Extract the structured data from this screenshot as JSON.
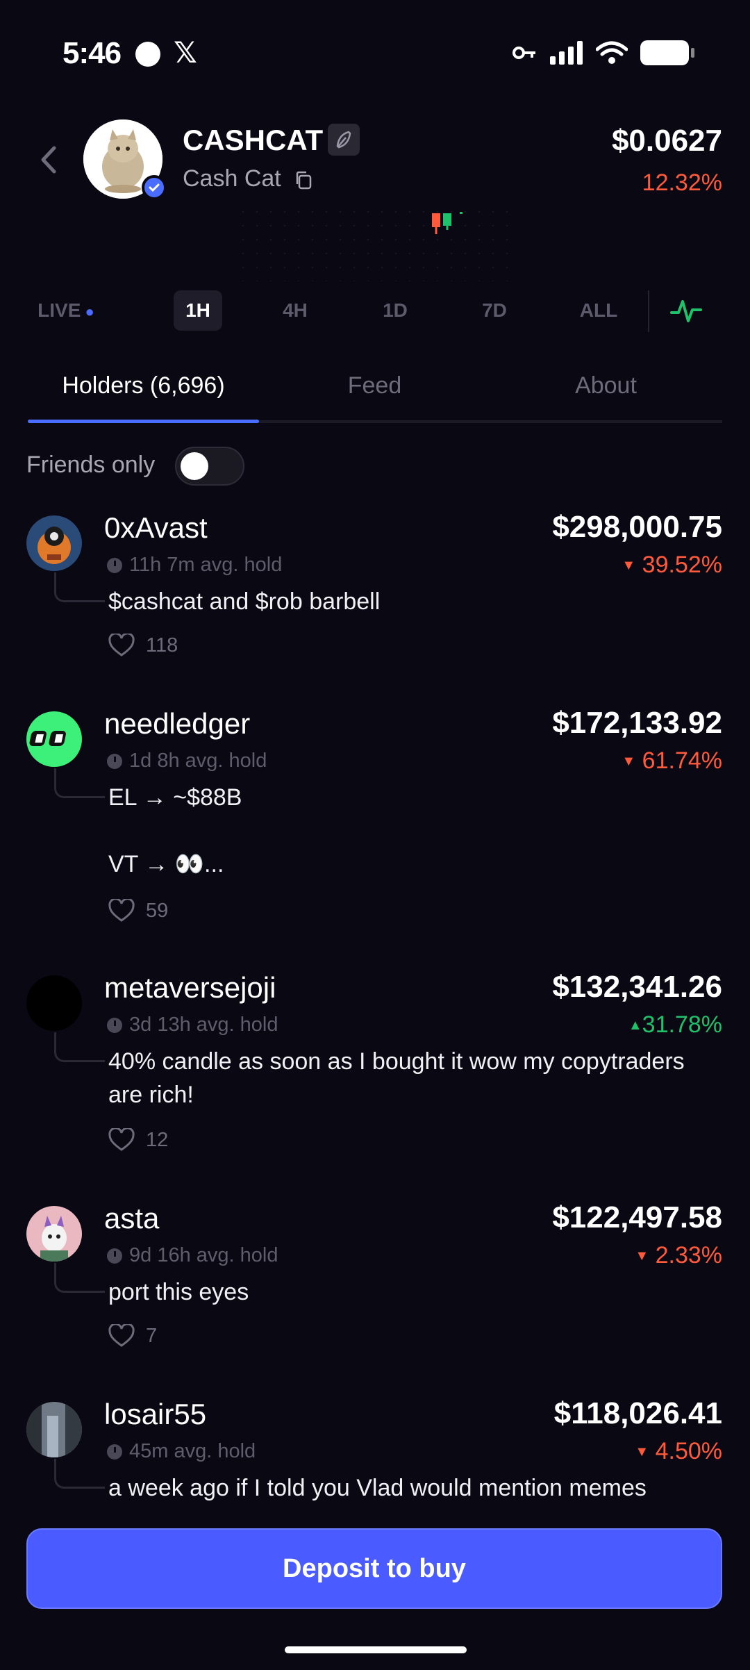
{
  "status_bar": {
    "time": "5:46",
    "x_glyph": "𝕏"
  },
  "token": {
    "ticker": "CASHCAT",
    "name": "Cash Cat",
    "price": "$0.0627",
    "change": "12.32%",
    "change_color": "#ff5a3c"
  },
  "timeframes": [
    "LIVE",
    "1H",
    "4H",
    "1D",
    "7D",
    "ALL"
  ],
  "active_timeframe": "1H",
  "tabs": [
    "Holders (6,696)",
    "Feed",
    "About"
  ],
  "friends_only_label": "Friends only",
  "holders": [
    {
      "name": "0xAvast",
      "value": "$298,000.75",
      "hold": "11h 7m avg. hold",
      "change": "39.52%",
      "direction": "down",
      "comment": "$cashcat and $rob barbell",
      "likes": "118"
    },
    {
      "name": "needledger",
      "value": "$172,133.92",
      "hold": "1d 8h avg. hold",
      "change": "61.74%",
      "direction": "down",
      "comment": "EL → ~$88B\n\nVT → 👀...",
      "likes": "59"
    },
    {
      "name": "metaversejoji",
      "value": "$132,341.26",
      "hold": "3d 13h avg. hold",
      "change": "31.78%",
      "direction": "up",
      "comment": "40% candle as soon as I bought it wow my copytraders are rich!",
      "likes": "12"
    },
    {
      "name": "asta",
      "value": "$122,497.58",
      "hold": "9d 16h avg. hold",
      "change": "2.33%",
      "direction": "down",
      "comment": "port this eyes",
      "likes": "7"
    },
    {
      "name": "losair55",
      "value": "$118,026.41",
      "hold": "45m avg. hold",
      "change": "4.50%",
      "direction": "down",
      "comment": "a week ago if I told you Vlad would mention memes",
      "likes": ""
    }
  ],
  "cta_label": "Deposit to buy",
  "arrows": {
    "down": "▼",
    "up": "▲"
  }
}
